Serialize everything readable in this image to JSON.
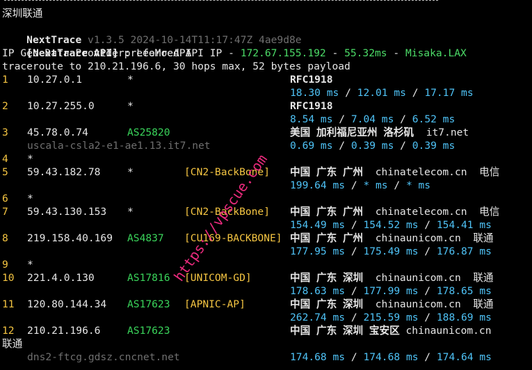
{
  "header": {
    "location": "深圳联通",
    "app_name": "NextTrace",
    "version": "v1.3.5 2024-10-14T11:17:47Z 4ae9d8e",
    "api_tag": "[NextTrace API]",
    "api_text": " preferred API IP - ",
    "api_ip": "172.67.155.192",
    "api_dash1": " - ",
    "api_latency": "55.32ms",
    "api_dash2": " - ",
    "api_node": "Misaka.LAX",
    "geo_provider": "IP Geo Data Provider: LeoMoeAPI",
    "traceroute_line": "traceroute to 210.21.196.6, 30 hops max, 52 bytes payload"
  },
  "hops": [
    {
      "num": "1",
      "ip": "10.27.0.1",
      "asn": "*",
      "tag": "",
      "geo": "RFC1918",
      "host": "",
      "isp": "",
      "rtt": [
        "18.30 ms",
        "12.01 ms",
        "17.17 ms"
      ],
      "rdns": ""
    },
    {
      "num": "2",
      "ip": "10.27.255.0",
      "asn": "*",
      "tag": "",
      "geo": "RFC1918",
      "host": "",
      "isp": "",
      "rtt": [
        "8.54 ms",
        "7.04 ms",
        "6.52 ms"
      ],
      "rdns": ""
    },
    {
      "num": "3",
      "ip": "45.78.0.74",
      "asn": "AS25820",
      "tag": "",
      "geo": "美国 加利福尼亚州 洛杉矶",
      "host": "it7.net",
      "isp": "",
      "rtt": [
        "0.69 ms",
        "0.39 ms",
        "0.39 ms"
      ],
      "rdns": "uscala-csla2-e1-ae1.13.it7.net"
    },
    {
      "num": "4",
      "ip": "*"
    },
    {
      "num": "5",
      "ip": "59.43.182.78",
      "asn": "*",
      "tag": "[CN2-BackBone]",
      "geo": "中国 广东 广州",
      "host": "chinatelecom.cn",
      "isp": "电信",
      "rtt": [
        "199.64 ms",
        "* ms",
        "* ms"
      ],
      "rdns": ""
    },
    {
      "num": "6",
      "ip": "*"
    },
    {
      "num": "7",
      "ip": "59.43.130.153",
      "asn": "*",
      "tag": "[CN2-BackBone]",
      "geo": "中国 广东 广州",
      "host": "chinatelecom.cn",
      "isp": "电信",
      "rtt": [
        "154.49 ms",
        "154.52 ms",
        "154.41 ms"
      ],
      "rdns": ""
    },
    {
      "num": "8",
      "ip": "219.158.40.169",
      "asn": "AS4837",
      "tag": "[CU169-BACKBONE]",
      "geo": "中国 广东 广州",
      "host": "chinaunicom.cn",
      "isp": "联通",
      "rtt": [
        "177.95 ms",
        "175.49 ms",
        "176.87 ms"
      ],
      "rdns": ""
    },
    {
      "num": "9",
      "ip": "*"
    },
    {
      "num": "10",
      "ip": "221.4.0.130",
      "asn": "AS17816",
      "tag": "[UNICOM-GD]",
      "geo": "中国 广东 深圳",
      "host": "chinaunicom.cn",
      "isp": "联通",
      "rtt": [
        "178.63 ms",
        "177.99 ms",
        "178.65 ms"
      ],
      "rdns": ""
    },
    {
      "num": "11",
      "ip": "120.80.144.34",
      "asn": "AS17623",
      "tag": "[APNIC-AP]",
      "geo": "中国 广东 深圳",
      "host": "chinaunicom.cn",
      "isp": "联通",
      "rtt": [
        "262.74 ms",
        "215.59 ms",
        "188.69 ms"
      ],
      "rdns": ""
    },
    {
      "num": "12",
      "ip": "210.21.196.6",
      "asn": "AS17623",
      "tag": "",
      "geo": "中国 广东 深圳 宝安区",
      "host": "chinaunicom.cn",
      "isp": "联通",
      "rtt": [
        "174.68 ms",
        "174.68 ms",
        "174.64 ms"
      ],
      "rdns": "dns2-ftcg.gdsz.cncnet.net"
    }
  ],
  "separator": " / ",
  "watermark": "https://vpscue.com",
  "colors": {
    "background": "#000000",
    "text": "#e6e6e6",
    "hop_number": "#f5c542",
    "asn": "#3ad55b",
    "tag": "#f5c542",
    "rtt": "#4fc3f7",
    "api_green": "#4cdc68",
    "rdns": "#6f6f6f",
    "watermark": "#ff2f88"
  }
}
